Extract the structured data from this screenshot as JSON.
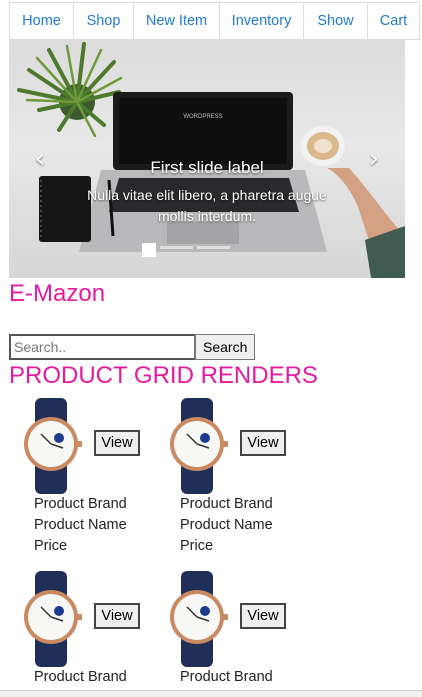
{
  "nav": {
    "items": [
      {
        "label": "Home"
      },
      {
        "label": "Shop"
      },
      {
        "label": "New Item"
      },
      {
        "label": "Inventory"
      },
      {
        "label": "Show"
      },
      {
        "label": "Cart"
      }
    ]
  },
  "carousel": {
    "caption_title": "First slide label",
    "caption_text": "Nulla vitae elit libero, a pharetra augue mollis interdum.",
    "slide_count": 3,
    "active_slide": 1
  },
  "brand": "E-Mazon",
  "search": {
    "placeholder": "Search..",
    "value": "",
    "button_label": "Search"
  },
  "grid_title": "PRODUCT GRID RENDERS",
  "products": [
    {
      "brand": "Product Brand",
      "name": "Product Name",
      "price": "Price",
      "view_label": "View"
    },
    {
      "brand": "Product Brand",
      "name": "Product Name",
      "price": "Price",
      "view_label": "View"
    },
    {
      "brand": "Product Brand",
      "name": "",
      "price": "",
      "view_label": "View"
    },
    {
      "brand": "Product Brand",
      "name": "",
      "price": "",
      "view_label": "View"
    }
  ],
  "colors": {
    "accent": "#e61aa1",
    "nav_link": "#1f7bd6"
  }
}
